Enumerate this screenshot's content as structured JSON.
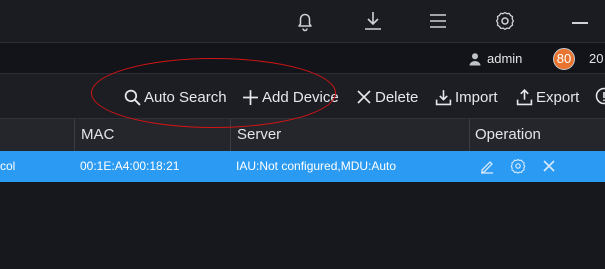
{
  "user": {
    "name": "admin",
    "badge": "80",
    "extra": "20"
  },
  "toolbar": {
    "auto_search": "Auto Search",
    "add_device": "Add Device",
    "delete": "Delete",
    "import": "Import",
    "export": "Export"
  },
  "table": {
    "columns": [
      "MAC",
      "Server",
      "Operation"
    ],
    "rows": [
      {
        "protocol_tail": "col",
        "mac": "00:1E:A4:00:18:21",
        "server": "IAU:Not configured,MDU:Auto"
      }
    ]
  },
  "colors": {
    "accent": "#2b9af3",
    "annotation": "#d21414",
    "badge": "#e8742f"
  }
}
